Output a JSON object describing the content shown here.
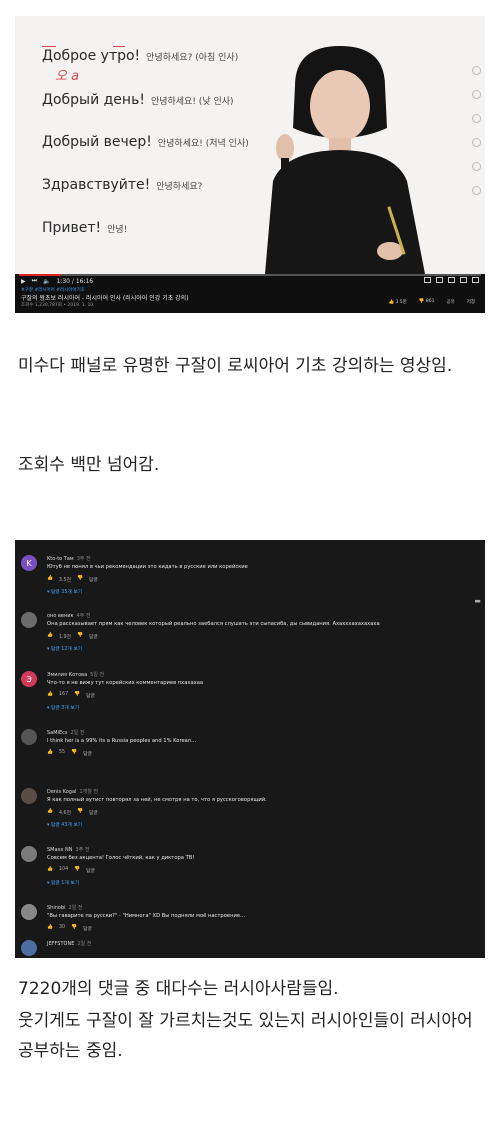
{
  "video": {
    "phrases": [
      {
        "ru": "Доброе утро!",
        "ko": "안녕하세요? (아침 인사)"
      },
      {
        "ru": "Добрый день!",
        "ko": "안녕하세요! (낮 인사)"
      },
      {
        "ru": "Добрый вечер!",
        "ko": "안녕하세요! (저녁 인사)"
      },
      {
        "ru": "Здравствуйте!",
        "ko": "안녕하세요?"
      },
      {
        "ru": "Привет!",
        "ko": "안녕!"
      }
    ],
    "pen_annotation": "오  а",
    "time": "1:30 / 16:16",
    "progress_fraction": 0.09,
    "tags": "#구잘 #러시아어 #러시아어기초",
    "title": "구잘의 왕초보 러시아어 - 러시아어 인사 (러시아어 인강 기초 강의)",
    "meta": "조회수 1,230,787회 • 2019. 1. 10.",
    "likes": "3.5만",
    "dislikes": "861",
    "share": "공유",
    "save": "저장"
  },
  "para1": "미수다 패널로 유명한 구잘이 로씨아어 기초 강의하는 영상임.",
  "para2": "조회수 백만 넘어감.",
  "comments": [
    {
      "initial": "K",
      "color": "#7a4fc2",
      "name": "Kto-to Там",
      "time": "3주 전",
      "text": "Ютуб не понял в чьи рекомендации это кидать в русские или корейские",
      "likes": "3.5천",
      "reply": "답글",
      "replies": "답글 35개 보기"
    },
    {
      "initial": "",
      "color": "#6b6b6b",
      "name": "оно веник",
      "time": "4주 전",
      "text": "Она рассказывает прям как человек который реально заебался слушать эти сыпасиба, ды сывидания. Ахахххахахахаха",
      "likes": "1.9천",
      "reply": "답글",
      "replies": "답글 12개 보기"
    },
    {
      "initial": "Э",
      "color": "#d23a5b",
      "name": "Эмилия Котова",
      "time": "5일 전",
      "text": "Что-то я не вижу тут корейских комментариев пхахахаа",
      "likes": "167",
      "reply": "답글",
      "replies": "답글 3개 보기"
    },
    {
      "initial": "",
      "color": "#555555",
      "name": "SaMiEcs",
      "time": "2일 전",
      "text": "I think her is a 99% its a Russia peoples and 1% Korean…",
      "likes": "55",
      "reply": "답글",
      "replies": ""
    },
    {
      "initial": "",
      "color": "#5a4d44",
      "name": "Denis Kogal",
      "time": "1개월 전",
      "text": "Я как полный аутист повторял за ней, не смотря на то, что я русскоговорящий.",
      "likes": "4.6천",
      "reply": "답글",
      "replies": "답글 43개 보기"
    },
    {
      "initial": "",
      "color": "#7a7a7a",
      "name": "SMaxx NN",
      "time": "3주 전",
      "text": "Совсем без акцента! Голос чёткий, как у диктора ТВ!",
      "likes": "104",
      "reply": "답글",
      "replies": "답글 1개 보기"
    },
    {
      "initial": "",
      "color": "#888888",
      "name": "Shinobi",
      "time": "2일 전",
      "text": "\"Вы гаварите па русски?\" - \"Нимнога\" XD Вы подняли моё настроение…",
      "likes": "30",
      "reply": "답글",
      "replies": ""
    },
    {
      "initial": "",
      "color": "#4a6fa0",
      "name": "JEFFSTONE",
      "time": "2일 전",
      "text": "",
      "likes": "",
      "reply": "",
      "replies": ""
    }
  ],
  "para3_line1": "7220개의 댓글 중 대다수는 러시아사람들임.",
  "para3_line2": "웃기게도 구잘이 잘 가르치는것도 있는지 러시아인들이 러시아어 공부하는 중임."
}
